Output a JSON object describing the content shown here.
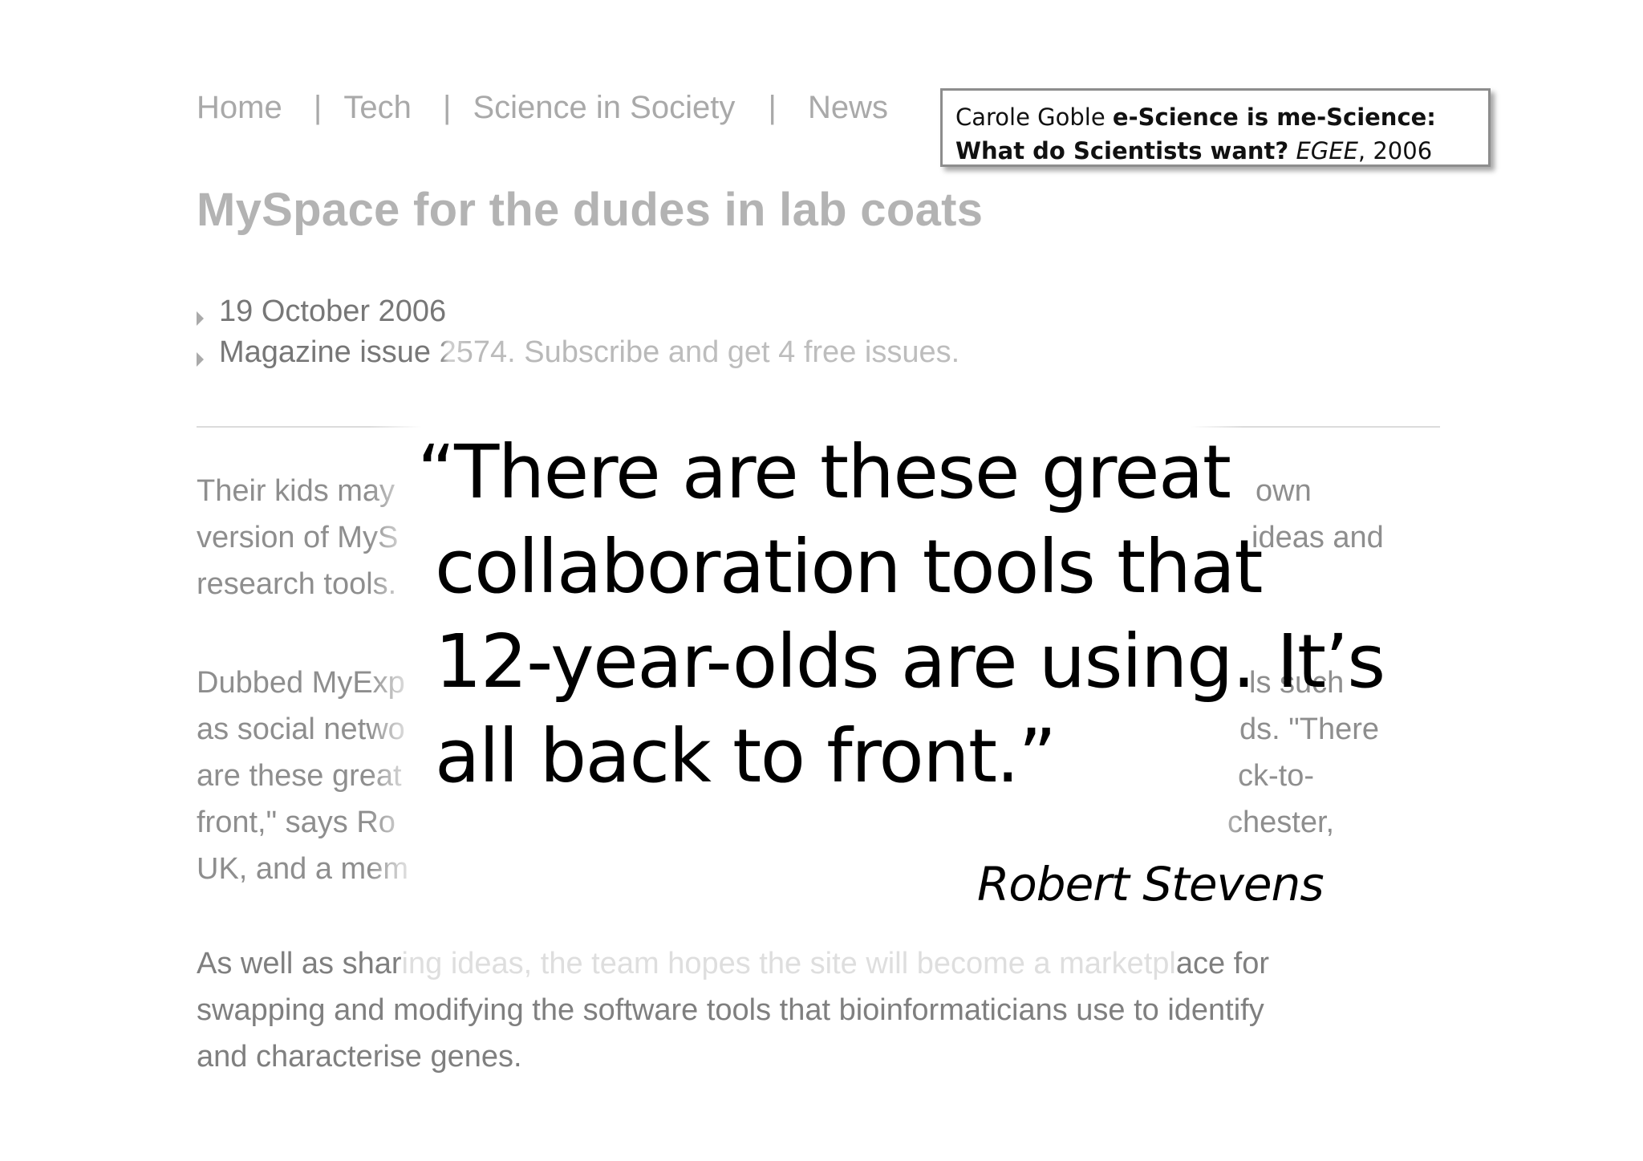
{
  "article": {
    "nav": {
      "items": [
        "Home",
        "Tech",
        "Science in Society",
        "News"
      ],
      "separator": "|"
    },
    "headline": "MySpace for the dudes in lab coats",
    "meta": {
      "date": "19 October 2006",
      "issue_prefix": "Magazine issue",
      "issue_number": "2574.",
      "subscribe_link": "Subscribe",
      "subscribe_rest": "and get 4 free issues."
    },
    "paragraph1": {
      "line1_left": "Their kids may",
      "line1_right": "own",
      "line2_left": "version of MyS",
      "line2_right": "ideas and",
      "line3_left": "research tools."
    },
    "paragraph2": {
      "line1_left": "Dubbed MyExp",
      "line1_right": "ls such",
      "line2_left": "as social netwo",
      "line2_right": "ds. \"There",
      "line3_left": "are these great",
      "line3_right": "ck-to-",
      "line4_left": "front,\" says Ro",
      "line4_right": "chester,",
      "line5_left": "UK, and a mem"
    },
    "paragraph3": {
      "line1_start": "As well as shar",
      "line1_faded": "ing ideas, the team hopes the site will become a marketpl",
      "line1_end": "ace for",
      "line2": "swapping and modifying the software tools that bioinformaticians use to identify",
      "line3": "and characterise genes."
    }
  },
  "citation": {
    "author": "Carole Goble",
    "title": "e-Science is me-Science: What do Scientists want?",
    "venue": "EGEE",
    "year": ", 2006"
  },
  "quote": {
    "line1": "“There are these great",
    "line2": "collaboration tools that",
    "line3": "12-year-olds are using. It’s",
    "line4": "all back to front.”"
  },
  "attribution": "Robert Stevens"
}
